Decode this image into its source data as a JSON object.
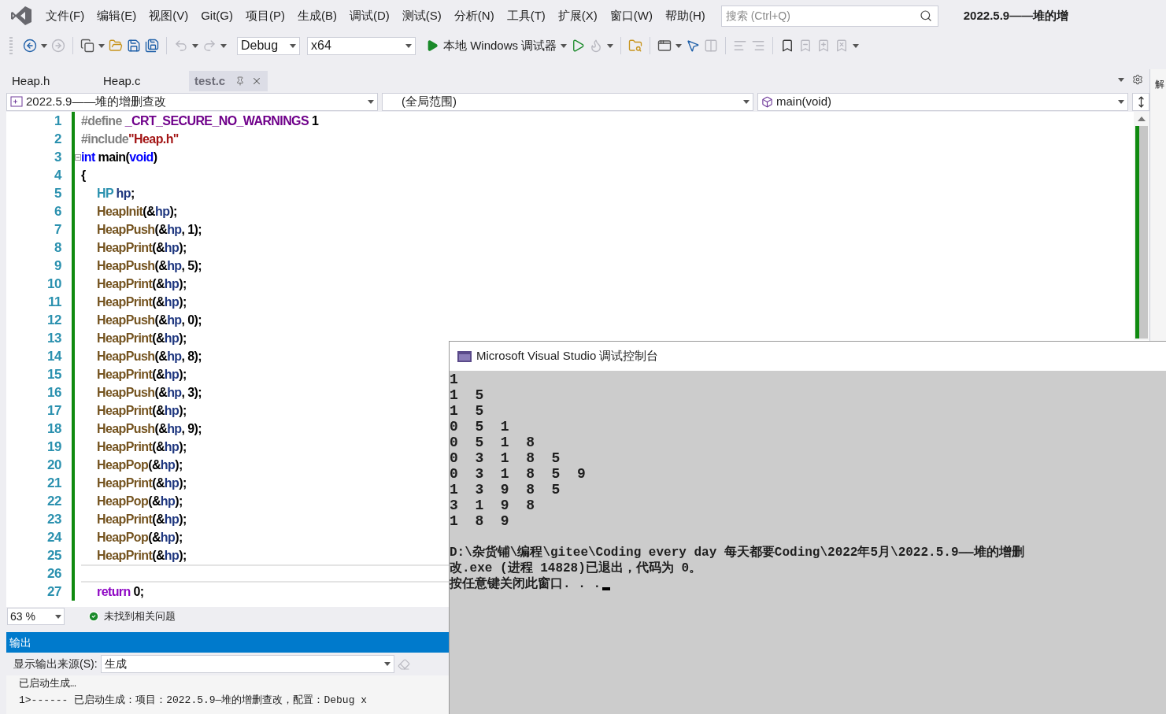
{
  "window": {
    "title": "2022.5.9——堆的增"
  },
  "menu": [
    "文件(F)",
    "编辑(E)",
    "视图(V)",
    "Git(G)",
    "项目(P)",
    "生成(B)",
    "调试(D)",
    "测试(S)",
    "分析(N)",
    "工具(T)",
    "扩展(X)",
    "窗口(W)",
    "帮助(H)"
  ],
  "search": {
    "placeholder": "搜索 (Ctrl+Q)"
  },
  "toolbar": {
    "configuration": "Debug",
    "platform": "x64",
    "run_label": "本地 Windows 调试器"
  },
  "tabs": [
    {
      "label": "Heap.h",
      "selected": false
    },
    {
      "label": "Heap.c",
      "selected": false
    },
    {
      "label": "test.c",
      "selected": true
    }
  ],
  "nav": {
    "project": "2022.5.9——堆的增删查改",
    "scope": "(全局范围)",
    "member": "main(void)"
  },
  "editor": {
    "lines": [
      {
        "number": "1",
        "collapsible": false,
        "current": false,
        "tokens": [
          {
            "text": "#define",
            "kind": "preproc"
          },
          {
            "text": " _CRT_SECURE_NO_WARNINGS",
            "kind": "macro"
          },
          {
            "text": " 1",
            "kind": "plain"
          }
        ]
      },
      {
        "number": "2",
        "collapsible": false,
        "current": false,
        "tokens": [
          {
            "text": "#include",
            "kind": "preproc"
          },
          {
            "text": "\"Heap.h\"",
            "kind": "string"
          }
        ]
      },
      {
        "number": "3",
        "collapsible": true,
        "current": false,
        "tokens": [
          {
            "text": "int",
            "kind": "keyword"
          },
          {
            "text": " main(",
            "kind": "plain"
          },
          {
            "text": "void",
            "kind": "keyword"
          },
          {
            "text": ")",
            "kind": "plain"
          }
        ]
      },
      {
        "number": "4",
        "collapsible": false,
        "current": false,
        "tokens": [
          {
            "text": "{",
            "kind": "plain"
          }
        ],
        "children": [
          {
            "number": "5",
            "collapsible": false,
            "current": false,
            "tokens": [
              {
                "text": "HP",
                "kind": "type"
              },
              {
                "text": " hp",
                "kind": "variable"
              },
              {
                "text": ";",
                "kind": "plain"
              }
            ]
          },
          {
            "number": "6",
            "collapsible": false,
            "current": false,
            "tokens": [
              {
                "text": "HeapInit",
                "kind": "function"
              },
              {
                "text": "(&",
                "kind": "plain"
              },
              {
                "text": "hp",
                "kind": "variable"
              },
              {
                "text": ");",
                "kind": "plain"
              }
            ]
          },
          {
            "number": "7",
            "collapsible": false,
            "current": false,
            "tokens": [
              {
                "text": "HeapPush",
                "kind": "function"
              },
              {
                "text": "(&",
                "kind": "plain"
              },
              {
                "text": "hp",
                "kind": "variable"
              },
              {
                "text": ", 1);",
                "kind": "plain"
              }
            ]
          },
          {
            "number": "8",
            "collapsible": false,
            "current": false,
            "tokens": [
              {
                "text": "HeapPrint",
                "kind": "function"
              },
              {
                "text": "(&",
                "kind": "plain"
              },
              {
                "text": "hp",
                "kind": "variable"
              },
              {
                "text": ");",
                "kind": "plain"
              }
            ]
          },
          {
            "number": "9",
            "collapsible": false,
            "current": false,
            "tokens": [
              {
                "text": "HeapPush",
                "kind": "function"
              },
              {
                "text": "(&",
                "kind": "plain"
              },
              {
                "text": "hp",
                "kind": "variable"
              },
              {
                "text": ", 5);",
                "kind": "plain"
              }
            ]
          },
          {
            "number": "10",
            "collapsible": false,
            "current": false,
            "tokens": [
              {
                "text": "HeapPrint",
                "kind": "function"
              },
              {
                "text": "(&",
                "kind": "plain"
              },
              {
                "text": "hp",
                "kind": "variable"
              },
              {
                "text": ");",
                "kind": "plain"
              }
            ]
          },
          {
            "number": "11",
            "collapsible": false,
            "current": false,
            "tokens": [
              {
                "text": "HeapPrint",
                "kind": "function"
              },
              {
                "text": "(&",
                "kind": "plain"
              },
              {
                "text": "hp",
                "kind": "variable"
              },
              {
                "text": ");",
                "kind": "plain"
              }
            ]
          },
          {
            "number": "12",
            "collapsible": false,
            "current": false,
            "tokens": [
              {
                "text": "HeapPush",
                "kind": "function"
              },
              {
                "text": "(&",
                "kind": "plain"
              },
              {
                "text": "hp",
                "kind": "variable"
              },
              {
                "text": ", 0);",
                "kind": "plain"
              }
            ]
          },
          {
            "number": "13",
            "collapsible": false,
            "current": false,
            "tokens": [
              {
                "text": "HeapPrint",
                "kind": "function"
              },
              {
                "text": "(&",
                "kind": "plain"
              },
              {
                "text": "hp",
                "kind": "variable"
              },
              {
                "text": ");",
                "kind": "plain"
              }
            ]
          },
          {
            "number": "14",
            "collapsible": false,
            "current": false,
            "tokens": [
              {
                "text": "HeapPush",
                "kind": "function"
              },
              {
                "text": "(&",
                "kind": "plain"
              },
              {
                "text": "hp",
                "kind": "variable"
              },
              {
                "text": ", 8);",
                "kind": "plain"
              }
            ]
          },
          {
            "number": "15",
            "collapsible": false,
            "current": false,
            "tokens": [
              {
                "text": "HeapPrint",
                "kind": "function"
              },
              {
                "text": "(&",
                "kind": "plain"
              },
              {
                "text": "hp",
                "kind": "variable"
              },
              {
                "text": ");",
                "kind": "plain"
              }
            ]
          },
          {
            "number": "16",
            "collapsible": false,
            "current": false,
            "tokens": [
              {
                "text": "HeapPush",
                "kind": "function"
              },
              {
                "text": "(&",
                "kind": "plain"
              },
              {
                "text": "hp",
                "kind": "variable"
              },
              {
                "text": ", 3);",
                "kind": "plain"
              }
            ]
          },
          {
            "number": "17",
            "collapsible": false,
            "current": false,
            "tokens": [
              {
                "text": "HeapPrint",
                "kind": "function"
              },
              {
                "text": "(&",
                "kind": "plain"
              },
              {
                "text": "hp",
                "kind": "variable"
              },
              {
                "text": ");",
                "kind": "plain"
              }
            ]
          },
          {
            "number": "18",
            "collapsible": false,
            "current": false,
            "tokens": [
              {
                "text": "HeapPush",
                "kind": "function"
              },
              {
                "text": "(&",
                "kind": "plain"
              },
              {
                "text": "hp",
                "kind": "variable"
              },
              {
                "text": ", 9);",
                "kind": "plain"
              }
            ]
          },
          {
            "number": "19",
            "collapsible": false,
            "current": false,
            "tokens": [
              {
                "text": "HeapPrint",
                "kind": "function"
              },
              {
                "text": "(&",
                "kind": "plain"
              },
              {
                "text": "hp",
                "kind": "variable"
              },
              {
                "text": ");",
                "kind": "plain"
              }
            ]
          },
          {
            "number": "20",
            "collapsible": false,
            "current": false,
            "tokens": [
              {
                "text": "HeapPop",
                "kind": "function"
              },
              {
                "text": "(&",
                "kind": "plain"
              },
              {
                "text": "hp",
                "kind": "variable"
              },
              {
                "text": ");",
                "kind": "plain"
              }
            ]
          },
          {
            "number": "21",
            "collapsible": false,
            "current": false,
            "tokens": [
              {
                "text": "HeapPrint",
                "kind": "function"
              },
              {
                "text": "(&",
                "kind": "plain"
              },
              {
                "text": "hp",
                "kind": "variable"
              },
              {
                "text": ");",
                "kind": "plain"
              }
            ]
          },
          {
            "number": "22",
            "collapsible": false,
            "current": false,
            "tokens": [
              {
                "text": "HeapPop",
                "kind": "function"
              },
              {
                "text": "(&",
                "kind": "plain"
              },
              {
                "text": "hp",
                "kind": "variable"
              },
              {
                "text": ");",
                "kind": "plain"
              }
            ]
          },
          {
            "number": "23",
            "collapsible": false,
            "current": false,
            "tokens": [
              {
                "text": "HeapPrint",
                "kind": "function"
              },
              {
                "text": "(&",
                "kind": "plain"
              },
              {
                "text": "hp",
                "kind": "variable"
              },
              {
                "text": ");",
                "kind": "plain"
              }
            ]
          },
          {
            "number": "24",
            "collapsible": false,
            "current": false,
            "tokens": [
              {
                "text": "HeapPop",
                "kind": "function"
              },
              {
                "text": "(&",
                "kind": "plain"
              },
              {
                "text": "hp",
                "kind": "variable"
              },
              {
                "text": ");",
                "kind": "plain"
              }
            ]
          },
          {
            "number": "25",
            "collapsible": false,
            "current": false,
            "tokens": [
              {
                "text": "HeapPrint",
                "kind": "function"
              },
              {
                "text": "(&",
                "kind": "plain"
              },
              {
                "text": "hp",
                "kind": "variable"
              },
              {
                "text": ");",
                "kind": "plain"
              }
            ]
          },
          {
            "number": "26",
            "collapsible": false,
            "current": true
          },
          {
            "number": "27",
            "collapsible": false,
            "current": false,
            "tokens": [
              {
                "text": "return",
                "kind": "control"
              },
              {
                "text": " 0;",
                "kind": "plain"
              }
            ]
          }
        ]
      }
    ]
  },
  "status": {
    "zoom": "63 %",
    "issues": "未找到相关问题"
  },
  "output": {
    "title": "输出",
    "source_label": "显示输出来源(S):",
    "source": "生成",
    "lines": [
      "已启动生成…",
      "1>------ 已启动生成：项目：2022.5.9—堆的增删查改，配置：Debug x"
    ]
  },
  "console": {
    "title": "Microsoft Visual Studio 调试控制台",
    "output_lines": [
      "1",
      "1  5",
      "1  5",
      "0  5  1",
      "0  5  1  8",
      "0  3  1  8  5",
      "0  3  1  8  5  9",
      "1  3  9  8  5",
      "3  1  9  8",
      "1  8  9"
    ],
    "exit_lines": [
      "D:\\杂货铺\\编程\\gitee\\Coding every day 每天都要Coding\\2022年5月\\2022.5.9——堆的增删",
      "改.exe (进程 14828)已退出，代码为 0。",
      "按任意键关闭此窗口. . ."
    ],
    "cursor": true
  },
  "side_panel": {
    "title": "解"
  }
}
